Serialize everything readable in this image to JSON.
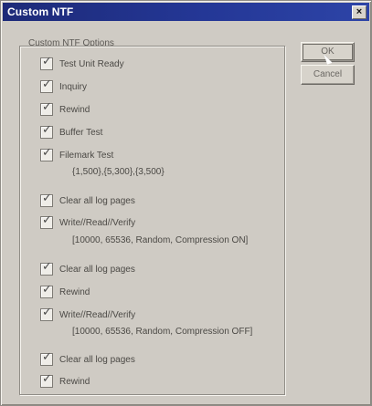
{
  "window": {
    "title": "Custom NTF"
  },
  "group_label": "Custom NTF Options",
  "buttons": {
    "ok": "OK",
    "cancel": "Cancel"
  },
  "options": [
    {
      "label": "Test Unit Ready",
      "checked": true
    },
    {
      "label": "Inquiry",
      "checked": true
    },
    {
      "label": "Rewind",
      "checked": true
    },
    {
      "label": "Buffer Test",
      "checked": true
    },
    {
      "label": "Filemark Test",
      "checked": true,
      "param": "{1,500},{5,300},{3,500}"
    },
    {
      "label": "Clear all log pages",
      "checked": true
    },
    {
      "label": "Write//Read//Verify",
      "checked": true,
      "param": "[10000, 65536, Random, Compression ON]"
    },
    {
      "label": "Clear all log pages",
      "checked": true
    },
    {
      "label": "Rewind",
      "checked": true
    },
    {
      "label": "Write//Read//Verify",
      "checked": true,
      "param": "[10000, 65536, Random, Compression OFF]"
    },
    {
      "label": "Clear all log pages",
      "checked": true
    },
    {
      "label": "Rewind",
      "checked": true
    }
  ]
}
